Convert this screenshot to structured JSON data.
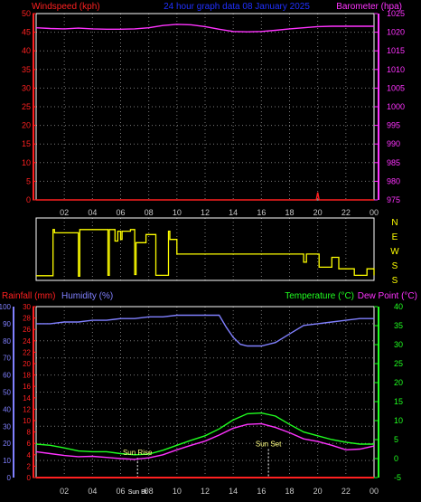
{
  "chart_data": [
    {
      "type": "line",
      "title": "24 hour graph data 08 January 2025",
      "left_axis_label": "Windspeed (kph)",
      "right_axis_label": "Barometer (hpa)",
      "x_ticks": [
        "02",
        "04",
        "06",
        "08",
        "10",
        "12",
        "14",
        "16",
        "18",
        "20",
        "22",
        "00"
      ],
      "x_range": [
        0,
        24
      ],
      "left_range": [
        0,
        50
      ],
      "left_ticks": [
        "0",
        "5",
        "10",
        "15",
        "20",
        "25",
        "30",
        "35",
        "40",
        "45",
        "50"
      ],
      "right_range": [
        975,
        1025
      ],
      "right_ticks": [
        "975",
        "980",
        "985",
        "990",
        "995",
        "1000",
        "1005",
        "1010",
        "1015",
        "1020",
        "1025"
      ],
      "grid": true,
      "series": [
        {
          "name": "Barometer (hpa)",
          "axis": "right",
          "color": "#ff33ff",
          "x": [
            0,
            1,
            2,
            3,
            4,
            5,
            6,
            7,
            8,
            9,
            10,
            11,
            12,
            13,
            14,
            15,
            16,
            17,
            18,
            19,
            20,
            21,
            22,
            23,
            24
          ],
          "y": [
            1021.2,
            1021.0,
            1020.9,
            1021.1,
            1020.9,
            1020.8,
            1020.8,
            1020.9,
            1021.2,
            1021.8,
            1022.1,
            1022.0,
            1021.5,
            1020.8,
            1020.2,
            1020.1,
            1020.2,
            1020.5,
            1020.9,
            1021.2,
            1021.5,
            1021.6,
            1021.6,
            1021.6,
            1021.6
          ]
        },
        {
          "name": "Windspeed (kph)",
          "axis": "left",
          "color": "#ff2020",
          "x": [
            0,
            19.9,
            20,
            20.1,
            24
          ],
          "y": [
            0,
            0,
            2,
            0,
            0
          ]
        }
      ]
    },
    {
      "type": "line",
      "title": "",
      "right_labels": [
        "N",
        "E",
        "W",
        "S",
        "S"
      ],
      "x_ticks": [
        "02",
        "04",
        "06",
        "08",
        "10",
        "12",
        "14",
        "16",
        "18",
        "20",
        "22",
        "00"
      ],
      "x_range": [
        0,
        24
      ],
      "y_range": [
        0,
        360
      ],
      "grid": true,
      "series": [
        {
          "name": "Wind direction",
          "color": "#ffff00",
          "x": [
            0,
            0.8,
            1.2,
            1.3,
            2.7,
            3.0,
            3.1,
            4.6,
            5.1,
            5.2,
            5.6,
            5.8,
            6.0,
            6.1,
            6.7,
            7.0,
            7.1,
            7.7,
            7.8,
            8.4,
            8.5,
            9.3,
            9.4,
            9.5,
            9.7,
            10.0,
            14.5,
            18.5,
            19.0,
            19.2,
            20.0,
            20.1,
            20.7,
            21.0,
            21.5,
            22.2,
            22.6,
            23.2,
            23.5,
            24
          ],
          "y": [
            18,
            18,
            300,
            280,
            280,
            15,
            300,
            300,
            20,
            300,
            230,
            290,
            240,
            290,
            300,
            25,
            220,
            220,
            270,
            270,
            20,
            20,
            290,
            240,
            240,
            150,
            150,
            150,
            100,
            150,
            150,
            70,
            70,
            130,
            60,
            60,
            20,
            20,
            60,
            20
          ]
        }
      ]
    },
    {
      "type": "line",
      "title": "",
      "labels": {
        "rainfall": "Rainfall (mm)",
        "humidity": "Humidity (%)",
        "temperature": "Temperature (°C)",
        "dewpoint": "Dew Point (°C)"
      },
      "x_ticks": [
        "02",
        "04",
        "06",
        "08",
        "10",
        "12",
        "14",
        "16",
        "18",
        "20",
        "22",
        "00"
      ],
      "x_range": [
        0,
        24
      ],
      "humidity_range": [
        0,
        100
      ],
      "humidity_ticks": [
        "0",
        "10",
        "20",
        "30",
        "40",
        "50",
        "60",
        "70",
        "80",
        "90",
        "100"
      ],
      "rain_range": [
        0,
        30
      ],
      "rain_ticks": [
        "0",
        "2",
        "4",
        "6",
        "8",
        "10",
        "12",
        "14",
        "16",
        "18",
        "20",
        "22",
        "24",
        "26",
        "28",
        "30"
      ],
      "temp_range": [
        -5,
        40
      ],
      "temp_ticks": [
        "-5",
        "0",
        "5",
        "10",
        "15",
        "20",
        "25",
        "30",
        "35",
        "40"
      ],
      "annotations": [
        {
          "x": 7.2,
          "text": "Sun Rise"
        },
        {
          "x": 16.5,
          "text": "Sun Set"
        }
      ],
      "bottom_marker": "Sun Bt",
      "grid": true,
      "series": [
        {
          "name": "Humidity (%)",
          "axis": "humidity",
          "color": "#8080ff",
          "x": [
            0,
            1,
            2,
            3,
            4,
            5,
            6,
            7,
            8,
            9,
            10,
            11,
            12,
            13,
            13.5,
            14,
            14.5,
            15,
            16,
            17,
            18,
            19,
            20,
            21,
            22,
            23,
            24
          ],
          "y": [
            90,
            90,
            91,
            91,
            92,
            92,
            93,
            93,
            94,
            94,
            95,
            95,
            95,
            95,
            88,
            82,
            78,
            77,
            77,
            79,
            84,
            89,
            90,
            91,
            92,
            93,
            93
          ]
        },
        {
          "name": "Temperature (°C)",
          "axis": "temp",
          "color": "#20ff20",
          "x": [
            0,
            1,
            2,
            3,
            4,
            5,
            6,
            7,
            8,
            9,
            10,
            11,
            12,
            13,
            14,
            15,
            16,
            17,
            18,
            19,
            20,
            21,
            22,
            23,
            24
          ],
          "y": [
            3.8,
            3.5,
            2.8,
            2.0,
            1.8,
            1.8,
            1.3,
            1.0,
            1.2,
            2.2,
            3.5,
            4.8,
            6.0,
            7.8,
            10.2,
            11.8,
            12.0,
            11.2,
            9.0,
            7.0,
            6.0,
            5.0,
            4.3,
            3.8,
            3.8
          ]
        },
        {
          "name": "Dew Point (°C)",
          "axis": "temp",
          "color": "#ff33ff",
          "x": [
            0,
            1,
            2,
            3,
            4,
            5,
            6,
            7,
            8,
            9,
            10,
            11,
            12,
            13,
            14,
            15,
            16,
            17,
            18,
            19,
            20,
            21,
            22,
            23,
            24
          ],
          "y": [
            1.8,
            1.3,
            0.8,
            0.5,
            0.6,
            0.3,
            0.0,
            -0.2,
            0.2,
            1.0,
            2.3,
            3.5,
            4.6,
            6.2,
            8.0,
            9.0,
            9.2,
            8.2,
            6.8,
            5.2,
            4.5,
            3.5,
            2.3,
            2.5,
            3.3
          ]
        },
        {
          "name": "Rainfall (mm)",
          "axis": "rain",
          "color": "#ff2020",
          "x": [
            0,
            24
          ],
          "y": [
            0,
            0
          ]
        }
      ]
    }
  ]
}
